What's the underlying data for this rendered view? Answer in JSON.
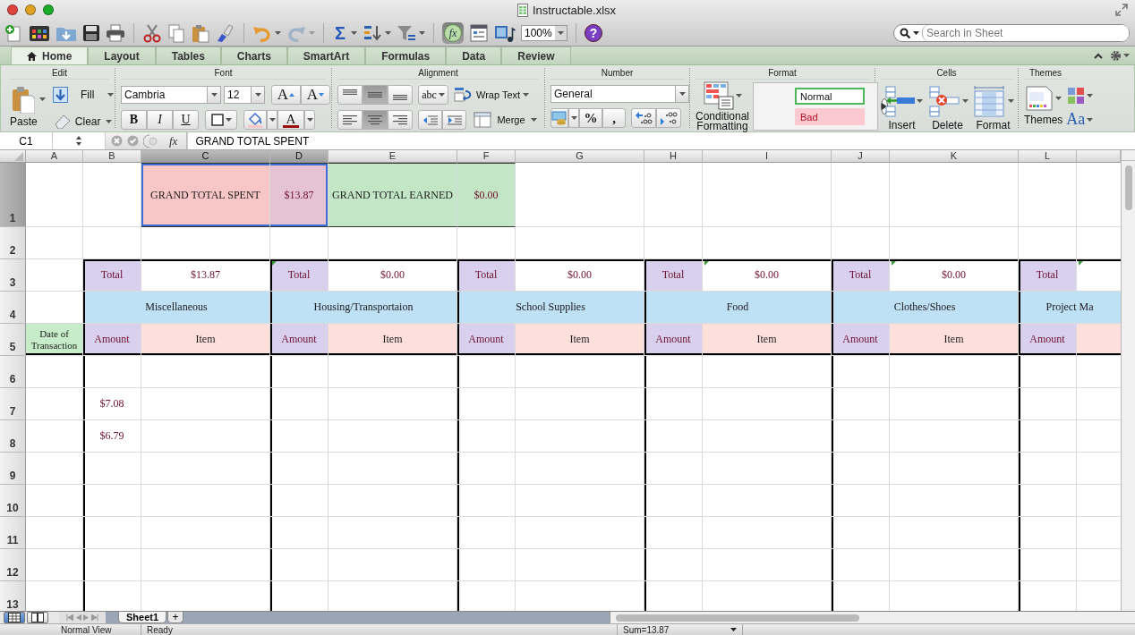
{
  "window": {
    "title": "Instructable.xlsx"
  },
  "toolbar": {
    "autosum": "Σ",
    "formula_builder": {
      "label": "fx",
      "on": true
    },
    "zoom": "100%",
    "help": "?",
    "search": {
      "placeholder": "Search in Sheet"
    }
  },
  "ribbon_tabs": [
    {
      "label": "Home",
      "selected": true
    },
    {
      "label": "Layout",
      "selected": false
    },
    {
      "label": "Tables",
      "selected": false
    },
    {
      "label": "Charts",
      "selected": false
    },
    {
      "label": "SmartArt",
      "selected": false
    },
    {
      "label": "Formulas",
      "selected": false
    },
    {
      "label": "Data",
      "selected": false
    },
    {
      "label": "Review",
      "selected": false
    }
  ],
  "ribbon": {
    "edit": {
      "title": "Edit",
      "paste": "Paste",
      "fill": "Fill",
      "clear": "Clear"
    },
    "font": {
      "title": "Font",
      "name": "Cambria",
      "size": "12",
      "grow": "A",
      "shrink": "A",
      "bold": {
        "label": "B",
        "on": false
      },
      "italic": {
        "label": "I",
        "on": false
      },
      "underline": {
        "label": "U",
        "on": false
      },
      "font_color": "A"
    },
    "alignment": {
      "title": "Alignment",
      "vertical": [
        {
          "selected": false
        },
        {
          "selected": true
        },
        {
          "selected": false
        }
      ],
      "horizontal": [
        {
          "selected": false
        },
        {
          "selected": true
        },
        {
          "selected": false
        }
      ],
      "orientation": "abc",
      "wrap_text": "Wrap Text",
      "merge": "Merge"
    },
    "number": {
      "title": "Number",
      "format": "General",
      "percent": "%",
      "comma": ","
    },
    "format": {
      "title": "Format",
      "conditional": "Conditional Formatting",
      "styles": [
        {
          "label": "Normal",
          "kind": "normal"
        },
        {
          "label": "Bad",
          "kind": "bad"
        }
      ]
    },
    "cells": {
      "title": "Cells",
      "buttons": [
        "Insert",
        "Delete",
        "Format"
      ]
    },
    "themes": {
      "title": "Themes",
      "themes": "Themes",
      "fonts": "Aa"
    }
  },
  "formula_bar": {
    "name_box": "C1",
    "fx": "fx",
    "content": "GRAND TOTAL SPENT"
  },
  "sheet": {
    "columns": [
      {
        "letter": "A",
        "selected": false
      },
      {
        "letter": "B",
        "selected": false
      },
      {
        "letter": "C",
        "selected": true
      },
      {
        "letter": "D",
        "selected": true
      },
      {
        "letter": "E",
        "selected": false
      },
      {
        "letter": "F",
        "selected": false
      },
      {
        "letter": "G",
        "selected": false
      },
      {
        "letter": "H",
        "selected": false
      },
      {
        "letter": "I",
        "selected": false
      },
      {
        "letter": "J",
        "selected": false
      },
      {
        "letter": "K",
        "selected": false
      },
      {
        "letter": "L",
        "selected": false
      }
    ],
    "rows": [
      {
        "number": "1",
        "selected": true,
        "cells": [
          null,
          null,
          {
            "text": "GRAND TOTAL SPENT",
            "kind": "spent"
          },
          {
            "text": "$13.87",
            "kind": "spent-sum"
          },
          {
            "text": "GRAND TOTAL EARNED",
            "kind": "earned"
          },
          {
            "text": "$0.00",
            "kind": "earned-sum"
          }
        ]
      },
      {
        "number": "2",
        "selected": false
      },
      {
        "number": "3",
        "selected": false,
        "cells": [
          null,
          {
            "text": "Total",
            "kind": "total-label"
          },
          {
            "text": "$13.87",
            "kind": "total-value"
          },
          {
            "text": "Total",
            "kind": "total-label",
            "flag": true
          },
          {
            "text": "$0.00",
            "kind": "total-value"
          },
          {
            "text": "Total",
            "kind": "total-label"
          },
          {
            "text": "$0.00",
            "kind": "total-value"
          },
          {
            "text": "Total",
            "kind": "total-label"
          },
          {
            "text": "$0.00",
            "kind": "total-value",
            "flag": true
          },
          {
            "text": "Total",
            "kind": "total-label"
          },
          {
            "text": "$0.00",
            "kind": "total-value",
            "flag": true
          },
          {
            "text": "Total",
            "kind": "total-label"
          },
          {
            "kind": "total-value",
            "flag": true
          }
        ]
      },
      {
        "number": "4",
        "selected": false,
        "cells": [
          null,
          {
            "text": "Miscellaneous",
            "kind": "category",
            "wide": true
          },
          {
            "text": "Housing/Transportaion",
            "kind": "category",
            "wide": true
          },
          {
            "text": "School Supplies",
            "kind": "category",
            "wide": true
          },
          {
            "text": "Food",
            "kind": "category",
            "wide": true
          },
          {
            "text": "Clothes/Shoes",
            "kind": "category",
            "wide": true
          },
          {
            "text": "Project Ma",
            "kind": "category",
            "wide": true
          }
        ]
      },
      {
        "number": "5",
        "selected": false,
        "cells": [
          {
            "text": "Date of Transaction",
            "kind": "date"
          },
          {
            "text": "Amount",
            "kind": "amount"
          },
          {
            "text": "Item",
            "kind": "item"
          },
          {
            "text": "Amount",
            "kind": "amount"
          },
          {
            "text": "Item",
            "kind": "item"
          },
          {
            "text": "Amount",
            "kind": "amount"
          },
          {
            "text": "Item",
            "kind": "item"
          },
          {
            "text": "Amount",
            "kind": "amount"
          },
          {
            "text": "Item",
            "kind": "item"
          },
          {
            "text": "Amount",
            "kind": "amount"
          },
          {
            "text": "Item",
            "kind": "item"
          },
          {
            "text": "Amount",
            "kind": "amount"
          },
          {
            "kind": "item"
          }
        ]
      },
      {
        "number": "6",
        "selected": false
      },
      {
        "number": "7",
        "selected": false,
        "cells": [
          null,
          {
            "text": "$7.08",
            "kind": "value"
          }
        ]
      },
      {
        "number": "8",
        "selected": false,
        "cells": [
          null,
          {
            "text": "$6.79",
            "kind": "value"
          }
        ]
      },
      {
        "number": "9",
        "selected": false
      },
      {
        "number": "10",
        "selected": false
      },
      {
        "number": "11",
        "selected": false
      },
      {
        "number": "12",
        "selected": false
      },
      {
        "number": "13",
        "selected": false
      }
    ]
  },
  "sheet_tabs": [
    {
      "label": "Sheet1",
      "selected": true
    }
  ],
  "add_sheet": "+",
  "views": [
    {
      "kind": "normal",
      "selected": true
    },
    {
      "kind": "layout",
      "selected": false
    }
  ],
  "status_bar": {
    "view": "Normal View",
    "mode": "Ready",
    "sum": "Sum=13.87"
  }
}
